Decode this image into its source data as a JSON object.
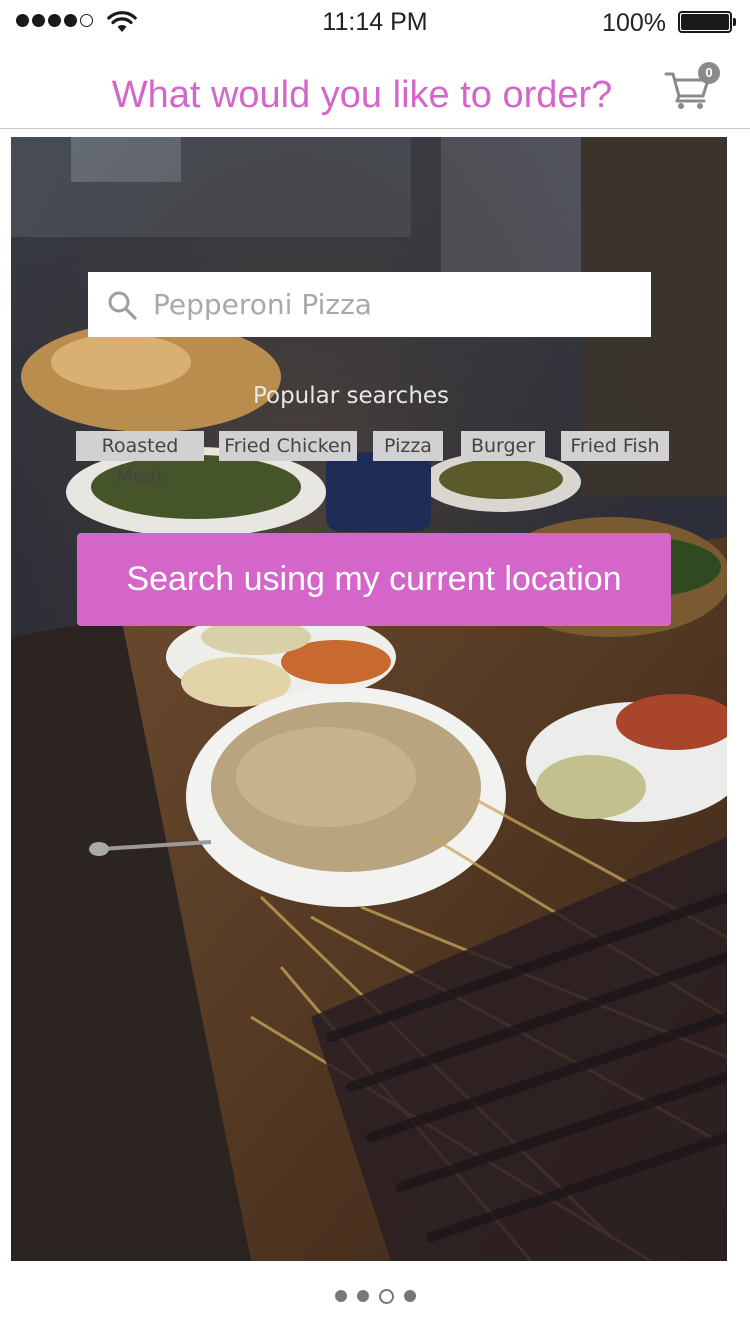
{
  "status_bar": {
    "time": "11:14 PM",
    "battery": "100%",
    "signal_bars_filled": 4,
    "signal_bars_total": 5,
    "icons": [
      "signal-dots-icon",
      "wifi-icon",
      "battery-icon"
    ]
  },
  "header": {
    "title": "What would you like to order?",
    "cart_icon": "shopping-cart-icon",
    "cart_count": "0"
  },
  "colors": {
    "accent": "#d466c9",
    "chip_bg": "#d1d1d1",
    "text_dark": "#222222"
  },
  "search": {
    "icon": "search-icon",
    "placeholder": "Pepperoni Pizza"
  },
  "popular": {
    "title": "Popular searches",
    "items": [
      "Roasted Meat",
      "Fried Chicken",
      "Pizza",
      "Burger",
      "Fried Fish"
    ]
  },
  "location_button": {
    "label": "Search using my current location"
  },
  "pager": {
    "count": 4,
    "active_index": 2
  }
}
